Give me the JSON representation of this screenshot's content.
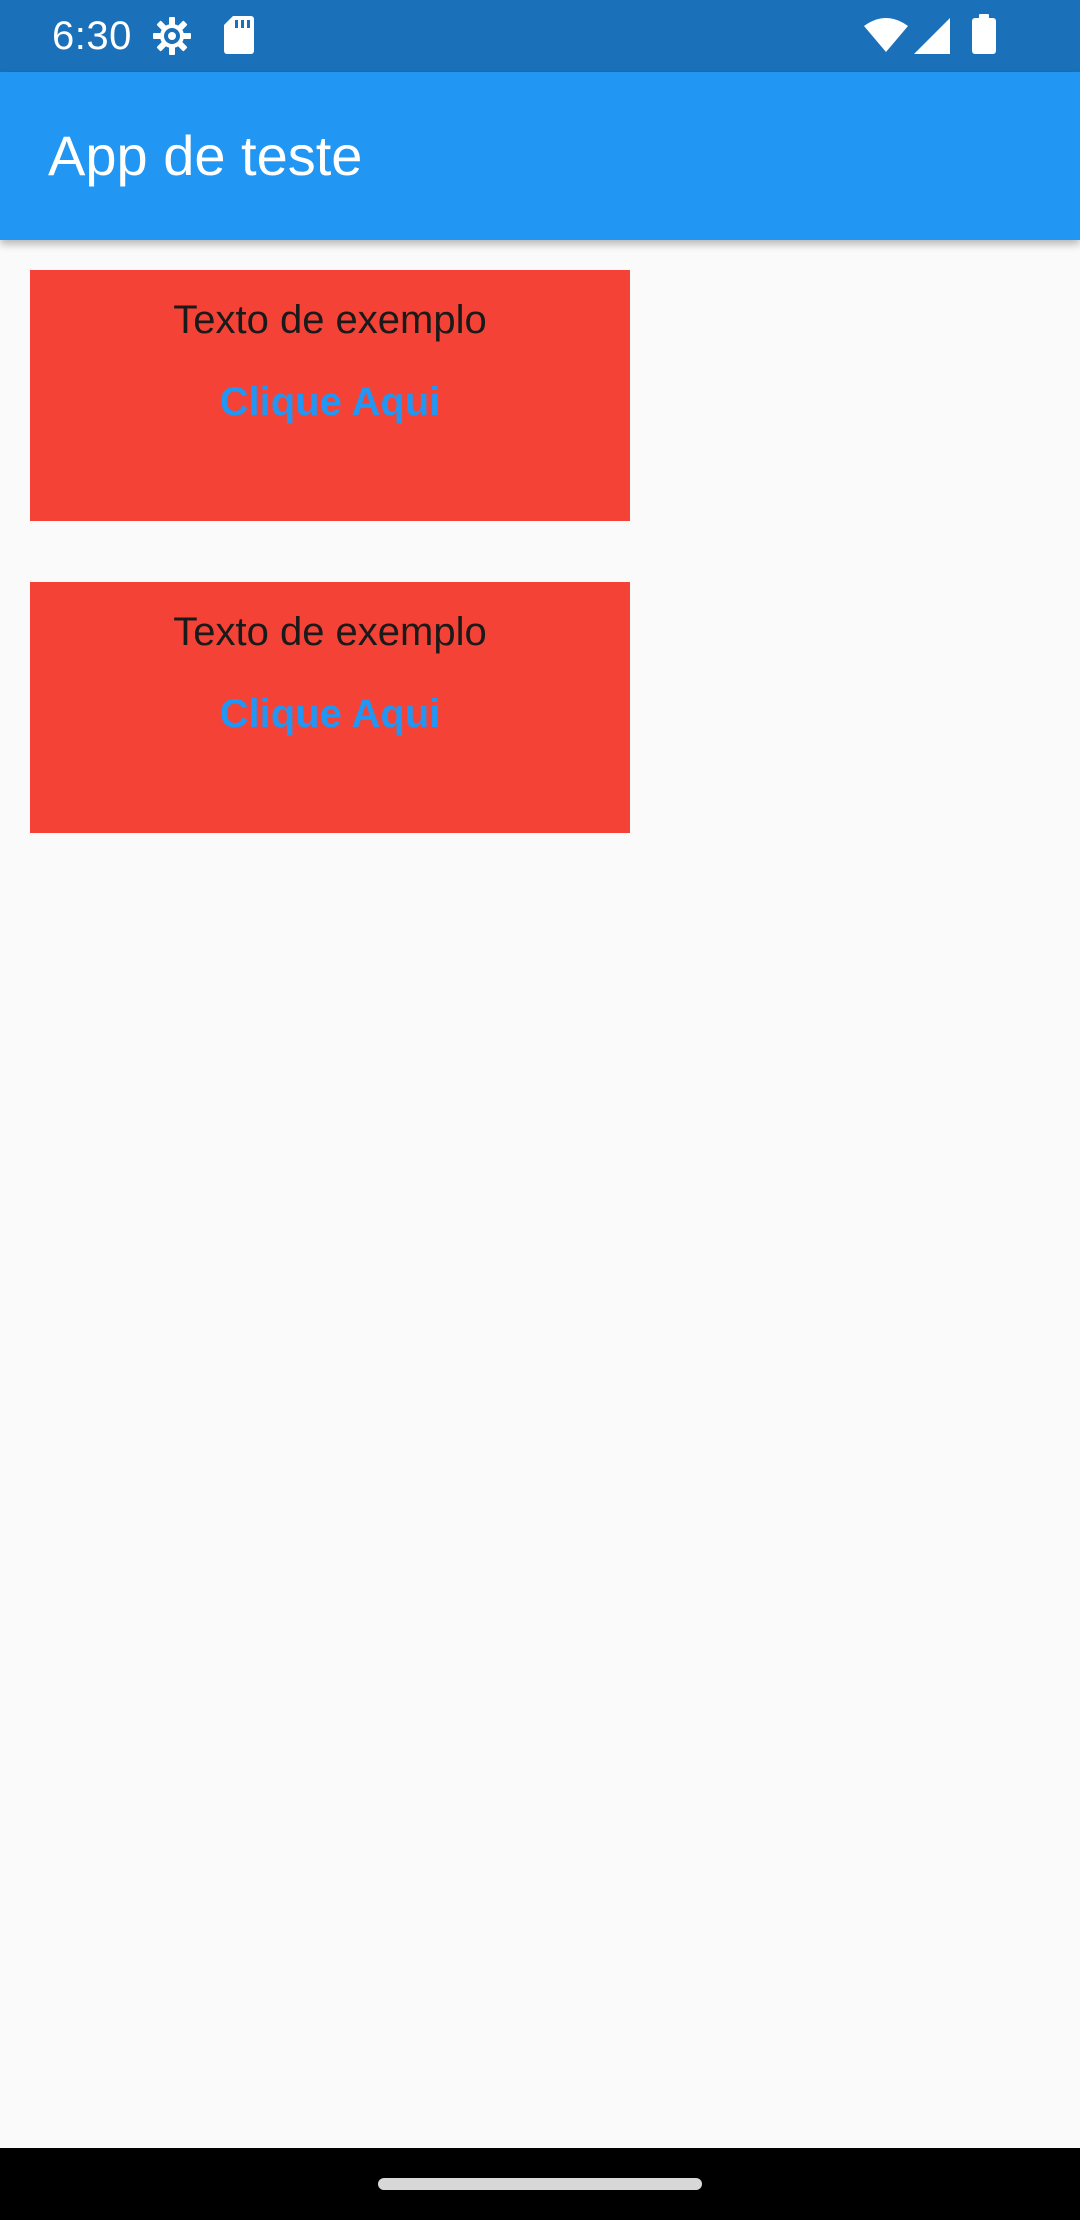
{
  "status_bar": {
    "time": "6:30",
    "left_icons": [
      "settings-icon",
      "sd-card-icon"
    ],
    "right_icons": [
      "wifi-icon",
      "cell-signal-icon",
      "battery-icon"
    ],
    "background": "#1b71b9"
  },
  "app_bar": {
    "title": "App de teste",
    "background": "#2196f3"
  },
  "cards": [
    {
      "text": "Texto de exemplo",
      "button_label": "Clique Aqui",
      "background": "#f44336"
    },
    {
      "text": "Texto de exemplo",
      "button_label": "Clique Aqui",
      "background": "#f44336"
    }
  ],
  "colors": {
    "accent": "#2196f3",
    "card": "#f44336",
    "page_background": "#fafafa"
  },
  "nav_bar": {
    "handle": "home-gesture-bar"
  }
}
